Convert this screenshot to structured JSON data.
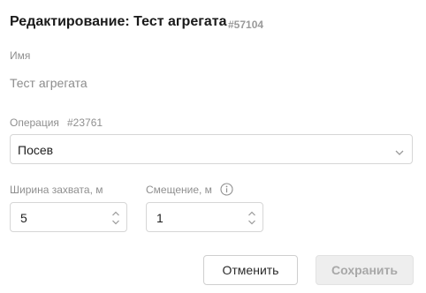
{
  "dialog": {
    "title": "Редактирование: Тест агрегата",
    "entity_id": "#57104"
  },
  "name_field": {
    "label": "Имя",
    "value": "Тест агрегата"
  },
  "operation_field": {
    "label": "Операция",
    "id": "#23761",
    "selected": "Посев",
    "icon": "chevron-down-icon"
  },
  "width_field": {
    "label": "Ширина захвата, м",
    "value": "5",
    "icon": "stepper-arrows-icon"
  },
  "offset_field": {
    "label": "Смещение, м",
    "value": "1",
    "icon": "stepper-arrows-icon",
    "help_icon": "info-icon"
  },
  "actions": {
    "cancel_label": "Отменить",
    "save_label": "Сохранить",
    "save_enabled": false
  },
  "colors": {
    "text_primary": "#1f1f1f",
    "text_muted": "#8f8f8f",
    "border": "#d6d6d6",
    "disabled_bg": "#eeeeee",
    "disabled_text": "#a8a8a8"
  }
}
